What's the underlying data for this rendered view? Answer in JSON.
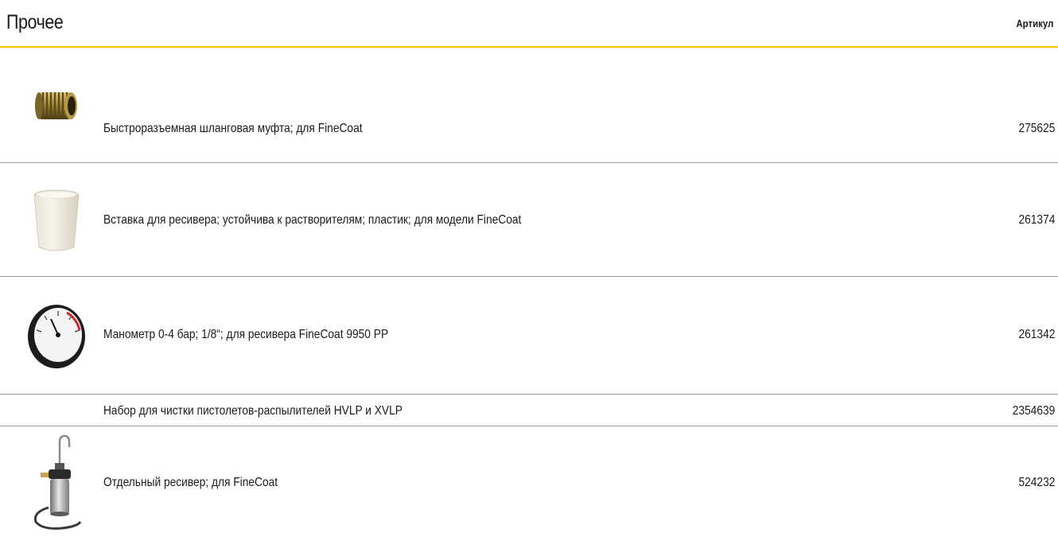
{
  "section": {
    "title": "Прочее",
    "column_header": "Артикул"
  },
  "items": [
    {
      "icon": "hose-coupling-photo",
      "description": "Быстроразъемная шланговая муфта; для FineCoat",
      "sku": "275625"
    },
    {
      "icon": "container-insert-photo",
      "description": "Вставка для ресивера; устойчива к растворителям; пластик; для модели FineCoat",
      "sku": "261374"
    },
    {
      "icon": "pressure-gauge-photo",
      "description": "Манометр 0-4 бар; 1/8“; для ресивера FineCoat 9950 PP",
      "sku": "261342"
    },
    {
      "icon": "",
      "description": "Набор для чистки пистолетов-распылителей HVLP и XVLP",
      "sku": "2354639"
    },
    {
      "icon": "pressure-tank-photo",
      "description": "Отдельный ресивер; для FineCoat",
      "sku": "524232"
    }
  ],
  "colors": {
    "accent_rule": "#f5c400",
    "row_divider": "#9a9a9a",
    "text": "#1a1a1a"
  }
}
